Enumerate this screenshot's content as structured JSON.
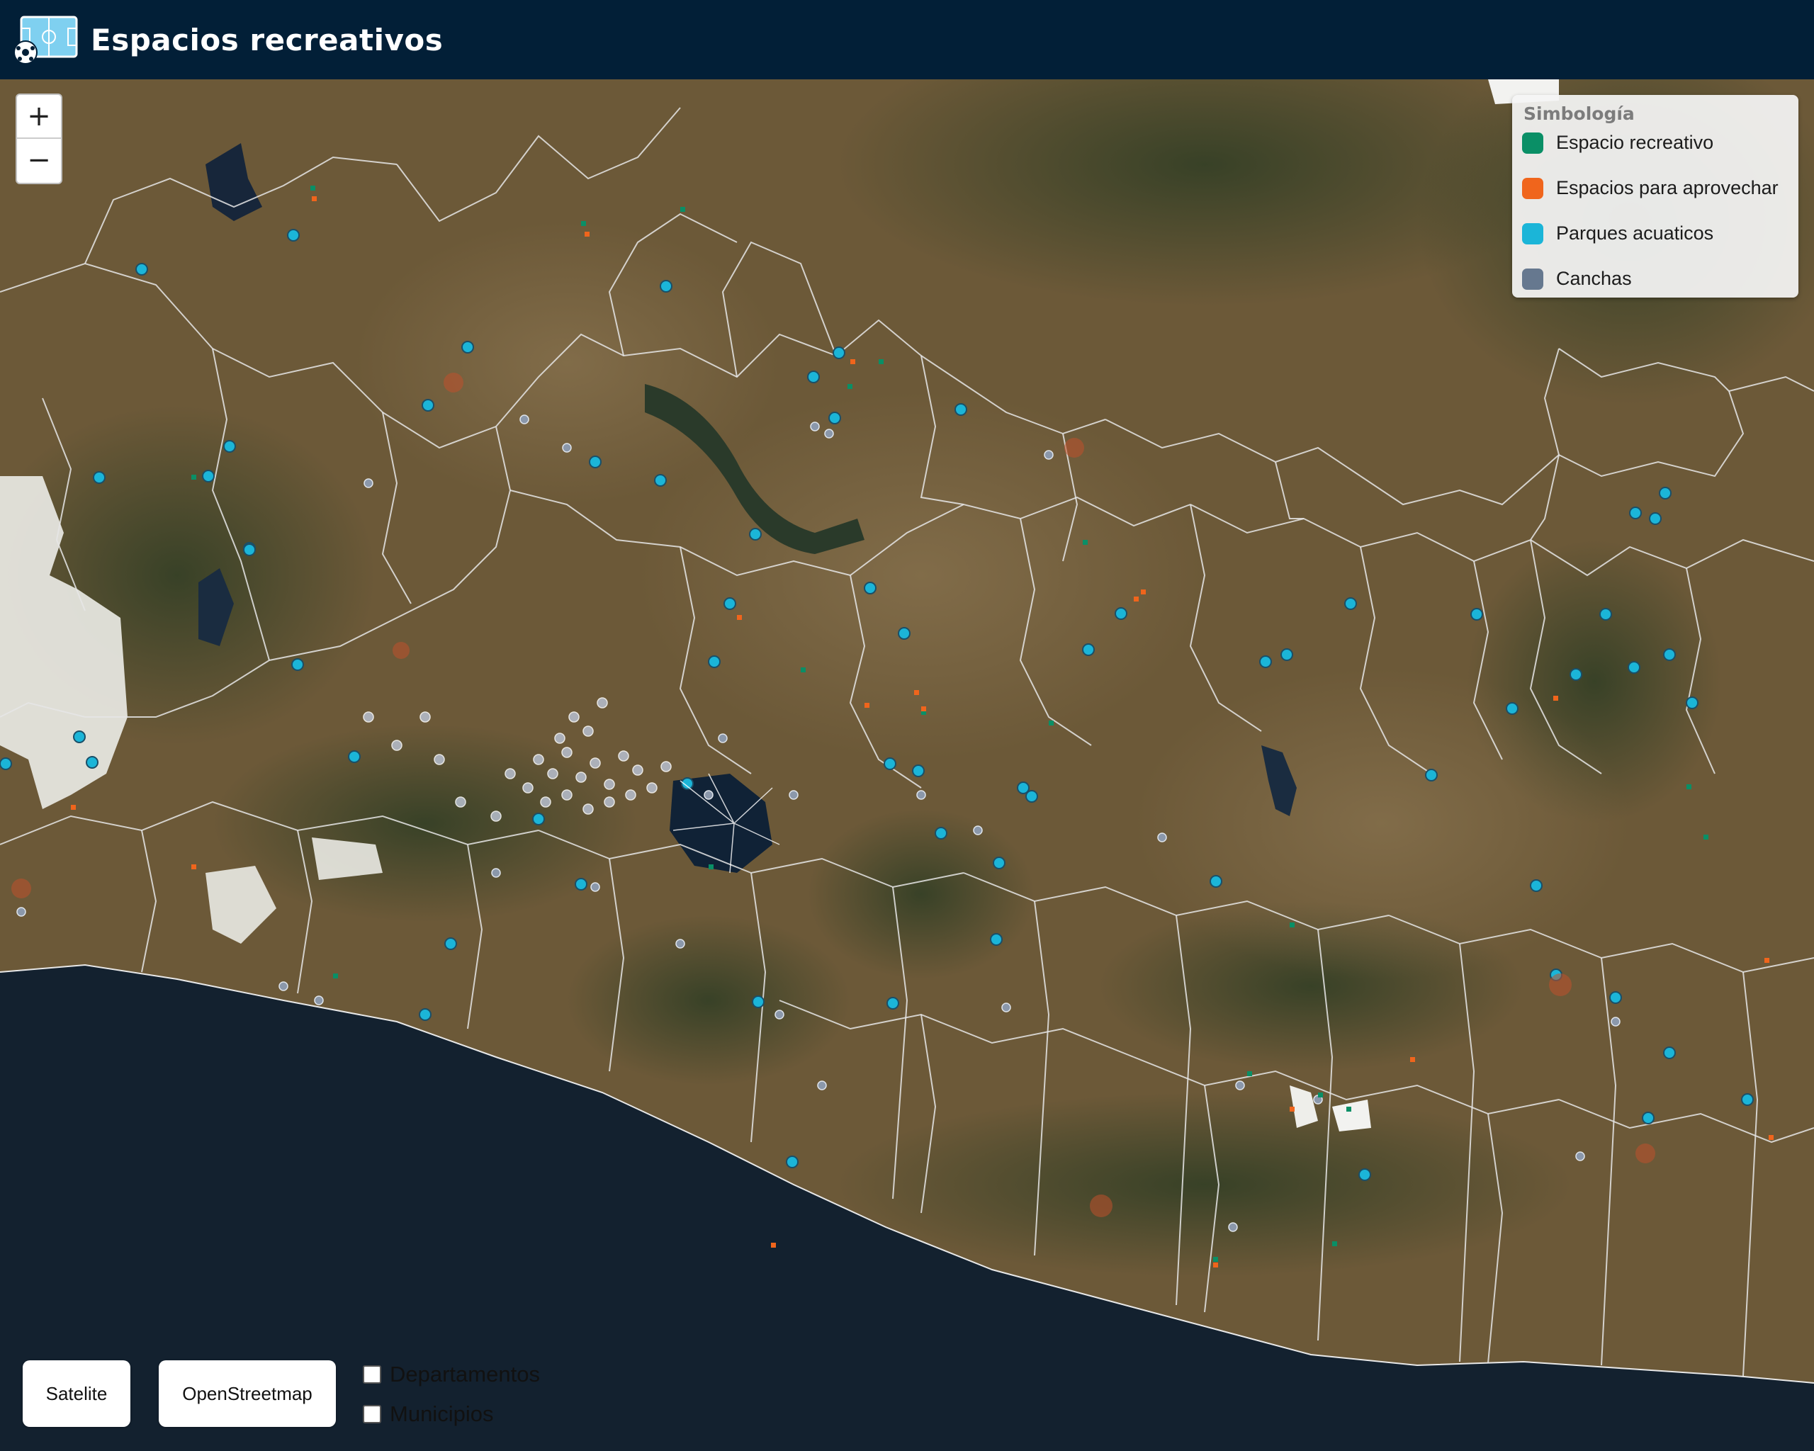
{
  "header": {
    "title": "Espacios recreativos",
    "logo_icon": "soccer-field-icon"
  },
  "zoom": {
    "in_label": "+",
    "out_label": "−"
  },
  "legend": {
    "title": "Simbología",
    "items": [
      {
        "label": "Espacio recreativo",
        "color": "#0a8f66"
      },
      {
        "label": "Espacios para aprovechar",
        "color": "#f0651c"
      },
      {
        "label": "Parques acuaticos",
        "color": "#1bb5d8"
      },
      {
        "label": "Canchas",
        "color": "#66788f"
      }
    ]
  },
  "basemaps": {
    "satellite_label": "Satelite",
    "osm_label": "OpenStreetmap"
  },
  "layers": [
    {
      "label": "Departamentos",
      "checked": false
    },
    {
      "label": "Municipios",
      "checked": false
    }
  ],
  "map_colors": {
    "land": "#6e5a3a",
    "vegetation": "#3d4a2c",
    "ocean": "#13212f",
    "boundary": "#e8e8e8"
  }
}
